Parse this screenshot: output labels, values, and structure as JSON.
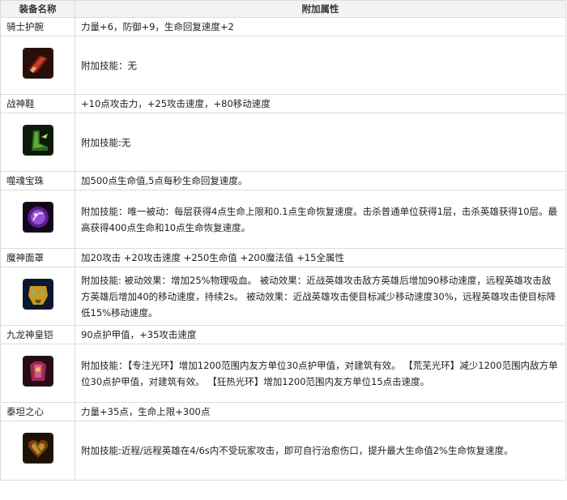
{
  "header": {
    "col1": "装备名称",
    "col2": "附加属性"
  },
  "items": [
    {
      "name": "骑士护腕",
      "stats": "力量+6，防御+9，生命回复速度+2",
      "skill": "附加技能：无",
      "icon": "bracer-icon"
    },
    {
      "name": "战神鞋",
      "stats": "+10点攻击力，+25攻击速度，+80移动速度",
      "skill": "附加技能:无",
      "icon": "boots-icon"
    },
    {
      "name": "噬魂宝珠",
      "stats": "加500点生命值,5点每秒生命回复速度。",
      "skill": "附加技能：唯一被动：每层获得4点生命上限和0.1点生命恢复速度。击杀普通单位获得1层，击杀英雄获得10层。最高获得400点生命和10点生命恢复速度。",
      "icon": "orb-icon"
    },
    {
      "name": "魔神面罩",
      "stats": "加20攻击 +20攻击速度 +250生命值 +200魔法值 +15全属性",
      "skill": "附加技能: 被动效果：增加25%物理吸血。 被动效果：近战英雄攻击敌方英雄后增加90移动速度，远程英雄攻击敌方英雄后增加40的移动速度，持续2s。 被动效果：近战英雄攻击使目标减少移动速度30%，远程英雄攻击使目标降低15%移动速度。",
      "icon": "mask-icon"
    },
    {
      "name": "九龙神皇铠",
      "stats": "90点护甲值，+35攻击速度",
      "skill": "附加技能：【专注光环】增加1200范围内友方单位30点护甲值，对建筑有效。 【荒芜光环】减少1200范围内敌方单位30点护甲值，对建筑有效。 【狂热光环】增加1200范围内友方单位15点击速度。",
      "icon": "armor-icon"
    },
    {
      "name": "泰坦之心",
      "stats": "力量+35点，生命上限+300点",
      "skill": "附加技能:近程/远程英雄在4/6s内不受玩家攻击，即可自行治愈伤口，提升最大生命值2%生命恢复速度。",
      "icon": "heart-icon"
    }
  ],
  "colors": {
    "header_bg": "#f3f3f3",
    "border": "#dcdcdc",
    "text": "#222222"
  }
}
